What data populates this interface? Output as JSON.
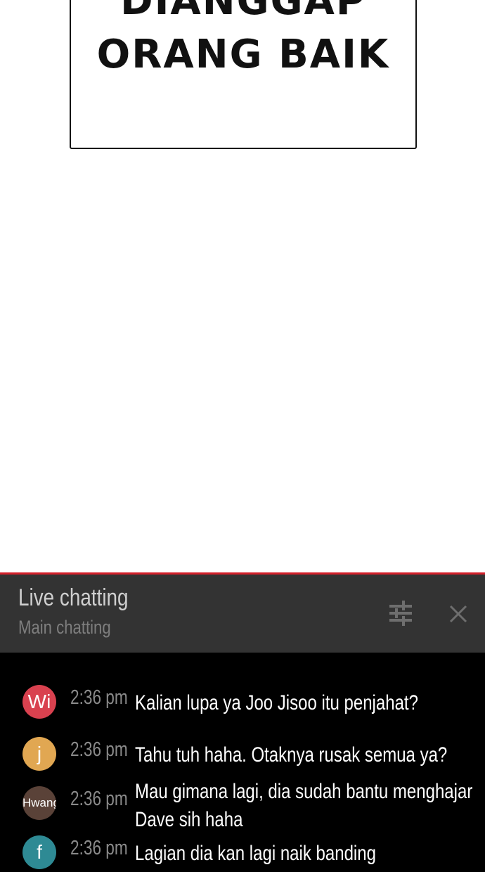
{
  "comic": {
    "speech_line_1": "DIANGGAP",
    "speech_line_2": "ORANG BAIK"
  },
  "chat": {
    "title": "Live chatting",
    "subtitle": "Main chatting",
    "accent_color": "#d4202a",
    "filter_icon": "sliders-icon",
    "close_icon": "close-icon",
    "messages": [
      {
        "avatar": "Wi",
        "avatar_color": "#d9414f",
        "time": "2:36 pm",
        "text": "Kalian lupa ya Joo Jisoo itu penjahat?"
      },
      {
        "avatar": "j",
        "avatar_color": "#e1a752",
        "time": "2:36 pm",
        "text": "Tahu tuh haha. Otaknya rusak semua ya?"
      },
      {
        "avatar": "Hwang",
        "avatar_color": "#5a4238",
        "time": "2:36 pm",
        "text": "Mau gimana lagi, dia sudah bantu menghajar Dave sih haha"
      },
      {
        "avatar": "f",
        "avatar_color": "#2e8a94",
        "time": "2:36 pm",
        "text": "Lagian dia kan lagi naik banding"
      }
    ]
  }
}
